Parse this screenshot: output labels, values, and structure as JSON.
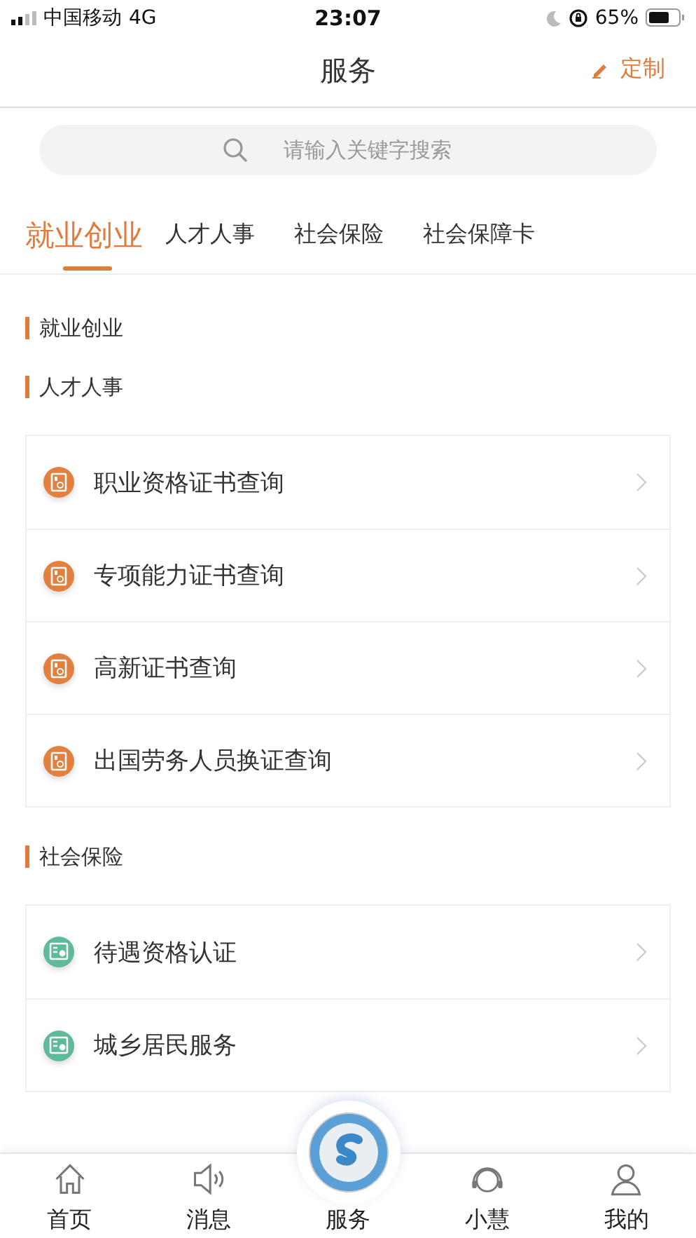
{
  "status_bar": {
    "carrier": "中国移动",
    "network": "4G",
    "time": "23:07",
    "battery": "65%"
  },
  "header": {
    "title": "服务",
    "action": "定制"
  },
  "search": {
    "placeholder": "请输入关键字搜索"
  },
  "tabs": [
    {
      "label": "就业创业",
      "selected": true
    },
    {
      "label": "人才人事",
      "selected": false
    },
    {
      "label": "社会保险",
      "selected": false
    },
    {
      "label": "社会保障卡",
      "selected": false
    }
  ],
  "sections": [
    {
      "title": "就业创业"
    },
    {
      "title": "人才人事",
      "items": [
        {
          "label": "职业资格证书查询",
          "kind": "cert"
        },
        {
          "label": "专项能力证书查询",
          "kind": "cert"
        },
        {
          "label": "高新证书查询",
          "kind": "cert"
        },
        {
          "label": "出国劳务人员换证查询",
          "kind": "cert"
        }
      ]
    },
    {
      "title": "社会保险",
      "items": [
        {
          "label": "待遇资格认证",
          "kind": "insurance"
        },
        {
          "label": "城乡居民服务",
          "kind": "insurance"
        }
      ]
    }
  ],
  "tab_bar": [
    {
      "label": "首页",
      "kind": "home"
    },
    {
      "label": "消息",
      "kind": "message"
    },
    {
      "label": "服务",
      "kind": "service"
    },
    {
      "label": "小慧",
      "kind": "assistant"
    },
    {
      "label": "我的",
      "kind": "profile"
    }
  ]
}
